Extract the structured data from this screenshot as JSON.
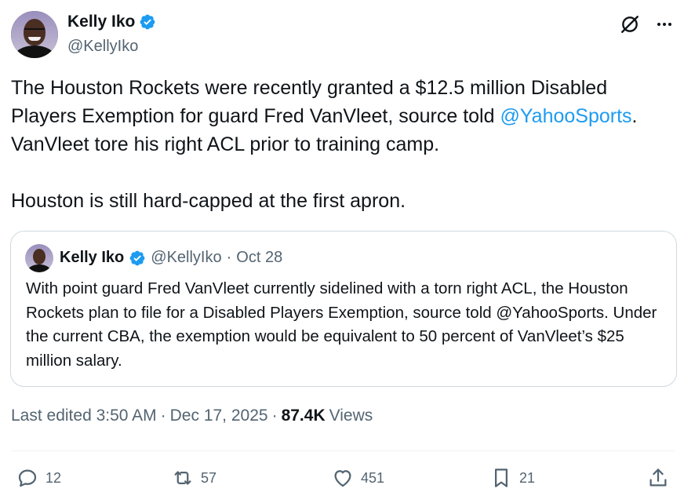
{
  "author": {
    "name": "Kelly Iko",
    "handle": "@KellyIko"
  },
  "tweet": {
    "line1": "The Houston Rockets were recently granted a $12.5 million Disabled",
    "line2_pre": "Players Exemption for guard Fred VanVleet, source told ",
    "line2_mention": "@YahooSports",
    "line2_post": ".",
    "line3": "VanVleet tore his right ACL prior to training camp.",
    "line4": "Houston is still hard-capped at the first apron."
  },
  "quote": {
    "name": "Kelly Iko",
    "handle": "@KellyIko",
    "separator": "·",
    "date": "Oct 28",
    "text": "With point guard Fred VanVleet currently sidelined with a torn right ACL, the Houston Rockets plan to file for a Disabled Players Exemption, source told @YahooSports. Under the current CBA, the exemption would be equivalent to 50 percent of VanVleet’s $25 million salary."
  },
  "meta": {
    "edited": "Last edited 3:50 AM",
    "sep1": "·",
    "date": "Dec 17, 2025",
    "sep2": "·",
    "views_count": "87.4K",
    "views_label": "Views"
  },
  "actions": {
    "replies": "12",
    "reposts": "57",
    "likes": "451",
    "bookmarks": "21"
  },
  "colors": {
    "accent": "#1d9bf0",
    "text": "#0f1419",
    "secondary": "#536471",
    "border": "#cfd9de"
  },
  "icons": [
    "verified-badge-icon",
    "grok-icon",
    "more-icon",
    "reply-icon",
    "repost-icon",
    "like-icon",
    "bookmark-icon",
    "share-icon"
  ]
}
